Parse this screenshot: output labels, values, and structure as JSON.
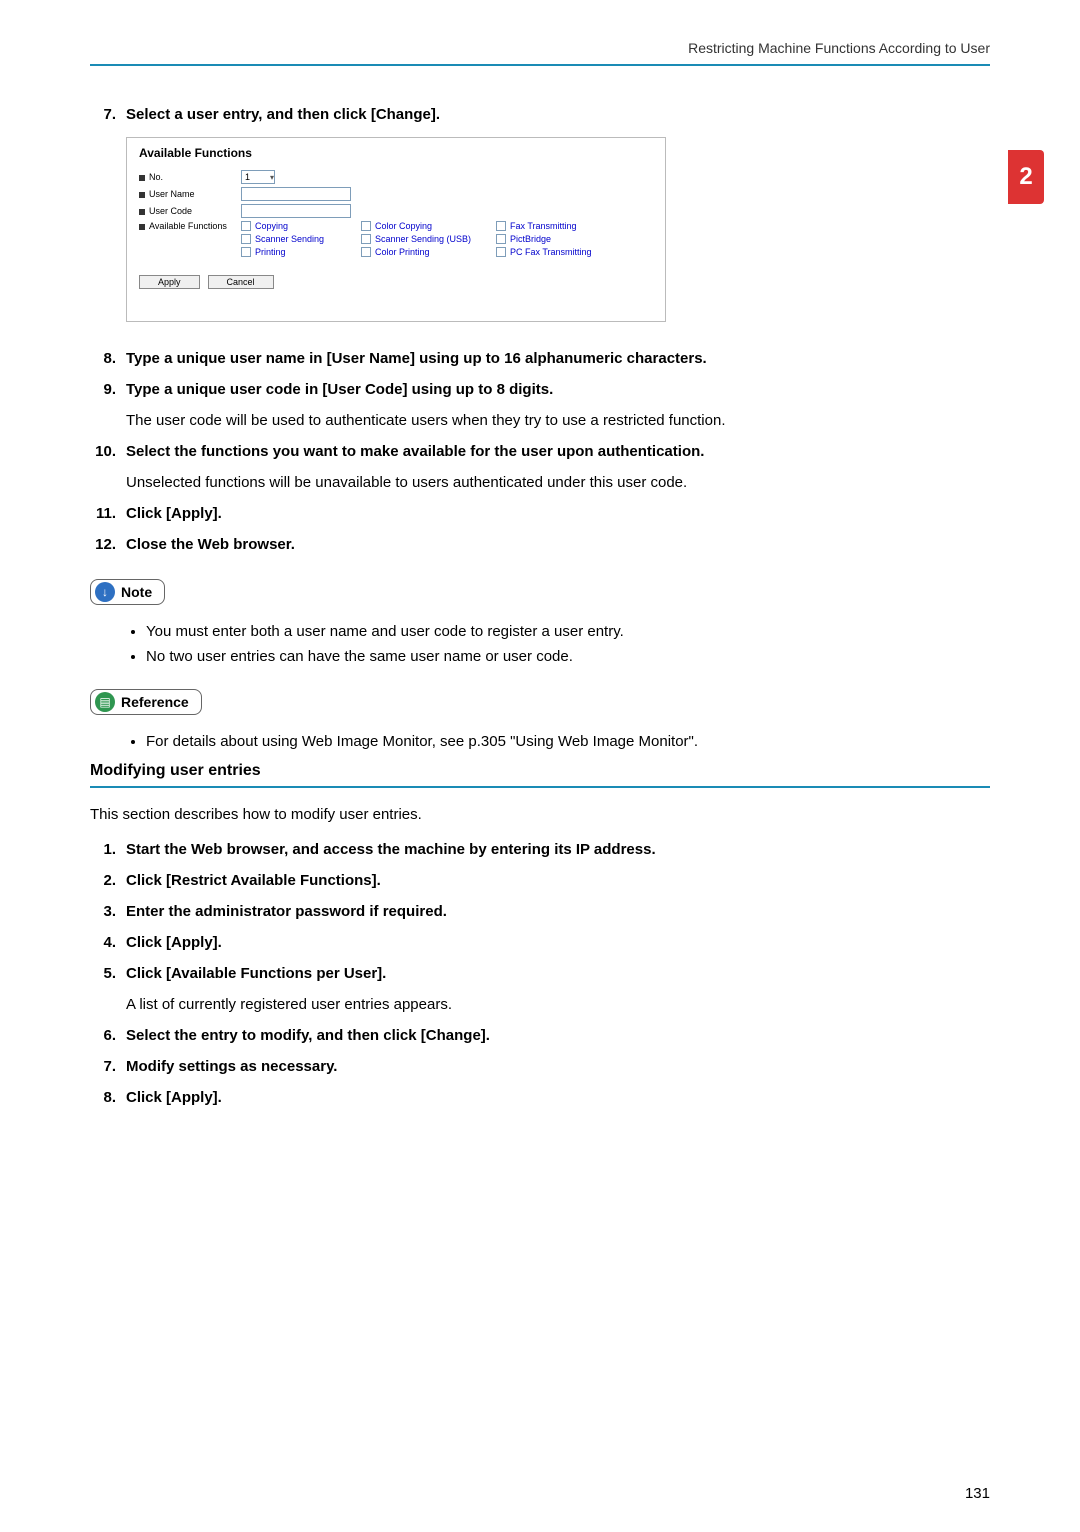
{
  "header": {
    "breadcrumb": "Restricting Machine Functions According to User"
  },
  "side_tab": "2",
  "steps_top": [
    {
      "num": "7.",
      "text": "Select a user entry, and then click [Change]."
    }
  ],
  "screenshot": {
    "title": "Available Functions",
    "row_no_label": "No.",
    "row_no_value": "1",
    "row_username_label": "User Name",
    "row_usercode_label": "User Code",
    "row_avail_label": "Available Functions",
    "funcs": {
      "r1c1": "Copying",
      "r1c2": "Color Copying",
      "r1c3": "Fax Transmitting",
      "r2c1": "Scanner Sending",
      "r2c2": "Scanner Sending (USB)",
      "r2c3": "PictBridge",
      "r3c1": "Printing",
      "r3c2": "Color Printing",
      "r3c3": "PC Fax Transmitting"
    },
    "apply": "Apply",
    "cancel": "Cancel"
  },
  "steps_mid": [
    {
      "num": "8.",
      "text": "Type a unique user name in [User Name] using up to 16 alphanumeric characters."
    },
    {
      "num": "9.",
      "text": "Type a unique user code in [User Code] using up to 8 digits.",
      "desc": "The user code will be used to authenticate users when they try to use a restricted function."
    },
    {
      "num": "10.",
      "text": "Select the functions you want to make available for the user upon authentication.",
      "desc": "Unselected functions will be unavailable to users authenticated under this user code."
    },
    {
      "num": "11.",
      "text": "Click [Apply]."
    },
    {
      "num": "12.",
      "text": "Close the Web browser."
    }
  ],
  "note": {
    "label": "Note",
    "items": [
      "You must enter both a user name and user code to register a user entry.",
      "No two user entries can have the same user name or user code."
    ]
  },
  "reference": {
    "label": "Reference",
    "items": [
      "For details about using Web Image Monitor, see p.305 \"Using Web Image Monitor\"."
    ]
  },
  "section": {
    "heading": "Modifying user entries",
    "intro": "This section describes how to modify user entries.",
    "steps": [
      {
        "num": "1.",
        "text": "Start the Web browser, and access the machine by entering its IP address."
      },
      {
        "num": "2.",
        "text": "Click [Restrict Available Functions]."
      },
      {
        "num": "3.",
        "text": "Enter the administrator password if required."
      },
      {
        "num": "4.",
        "text": "Click [Apply]."
      },
      {
        "num": "5.",
        "text": "Click [Available Functions per User].",
        "desc": "A list of currently registered user entries appears."
      },
      {
        "num": "6.",
        "text": "Select the entry to modify, and then click [Change]."
      },
      {
        "num": "7.",
        "text": "Modify settings as necessary."
      },
      {
        "num": "8.",
        "text": "Click [Apply]."
      }
    ]
  },
  "page_number": "131"
}
